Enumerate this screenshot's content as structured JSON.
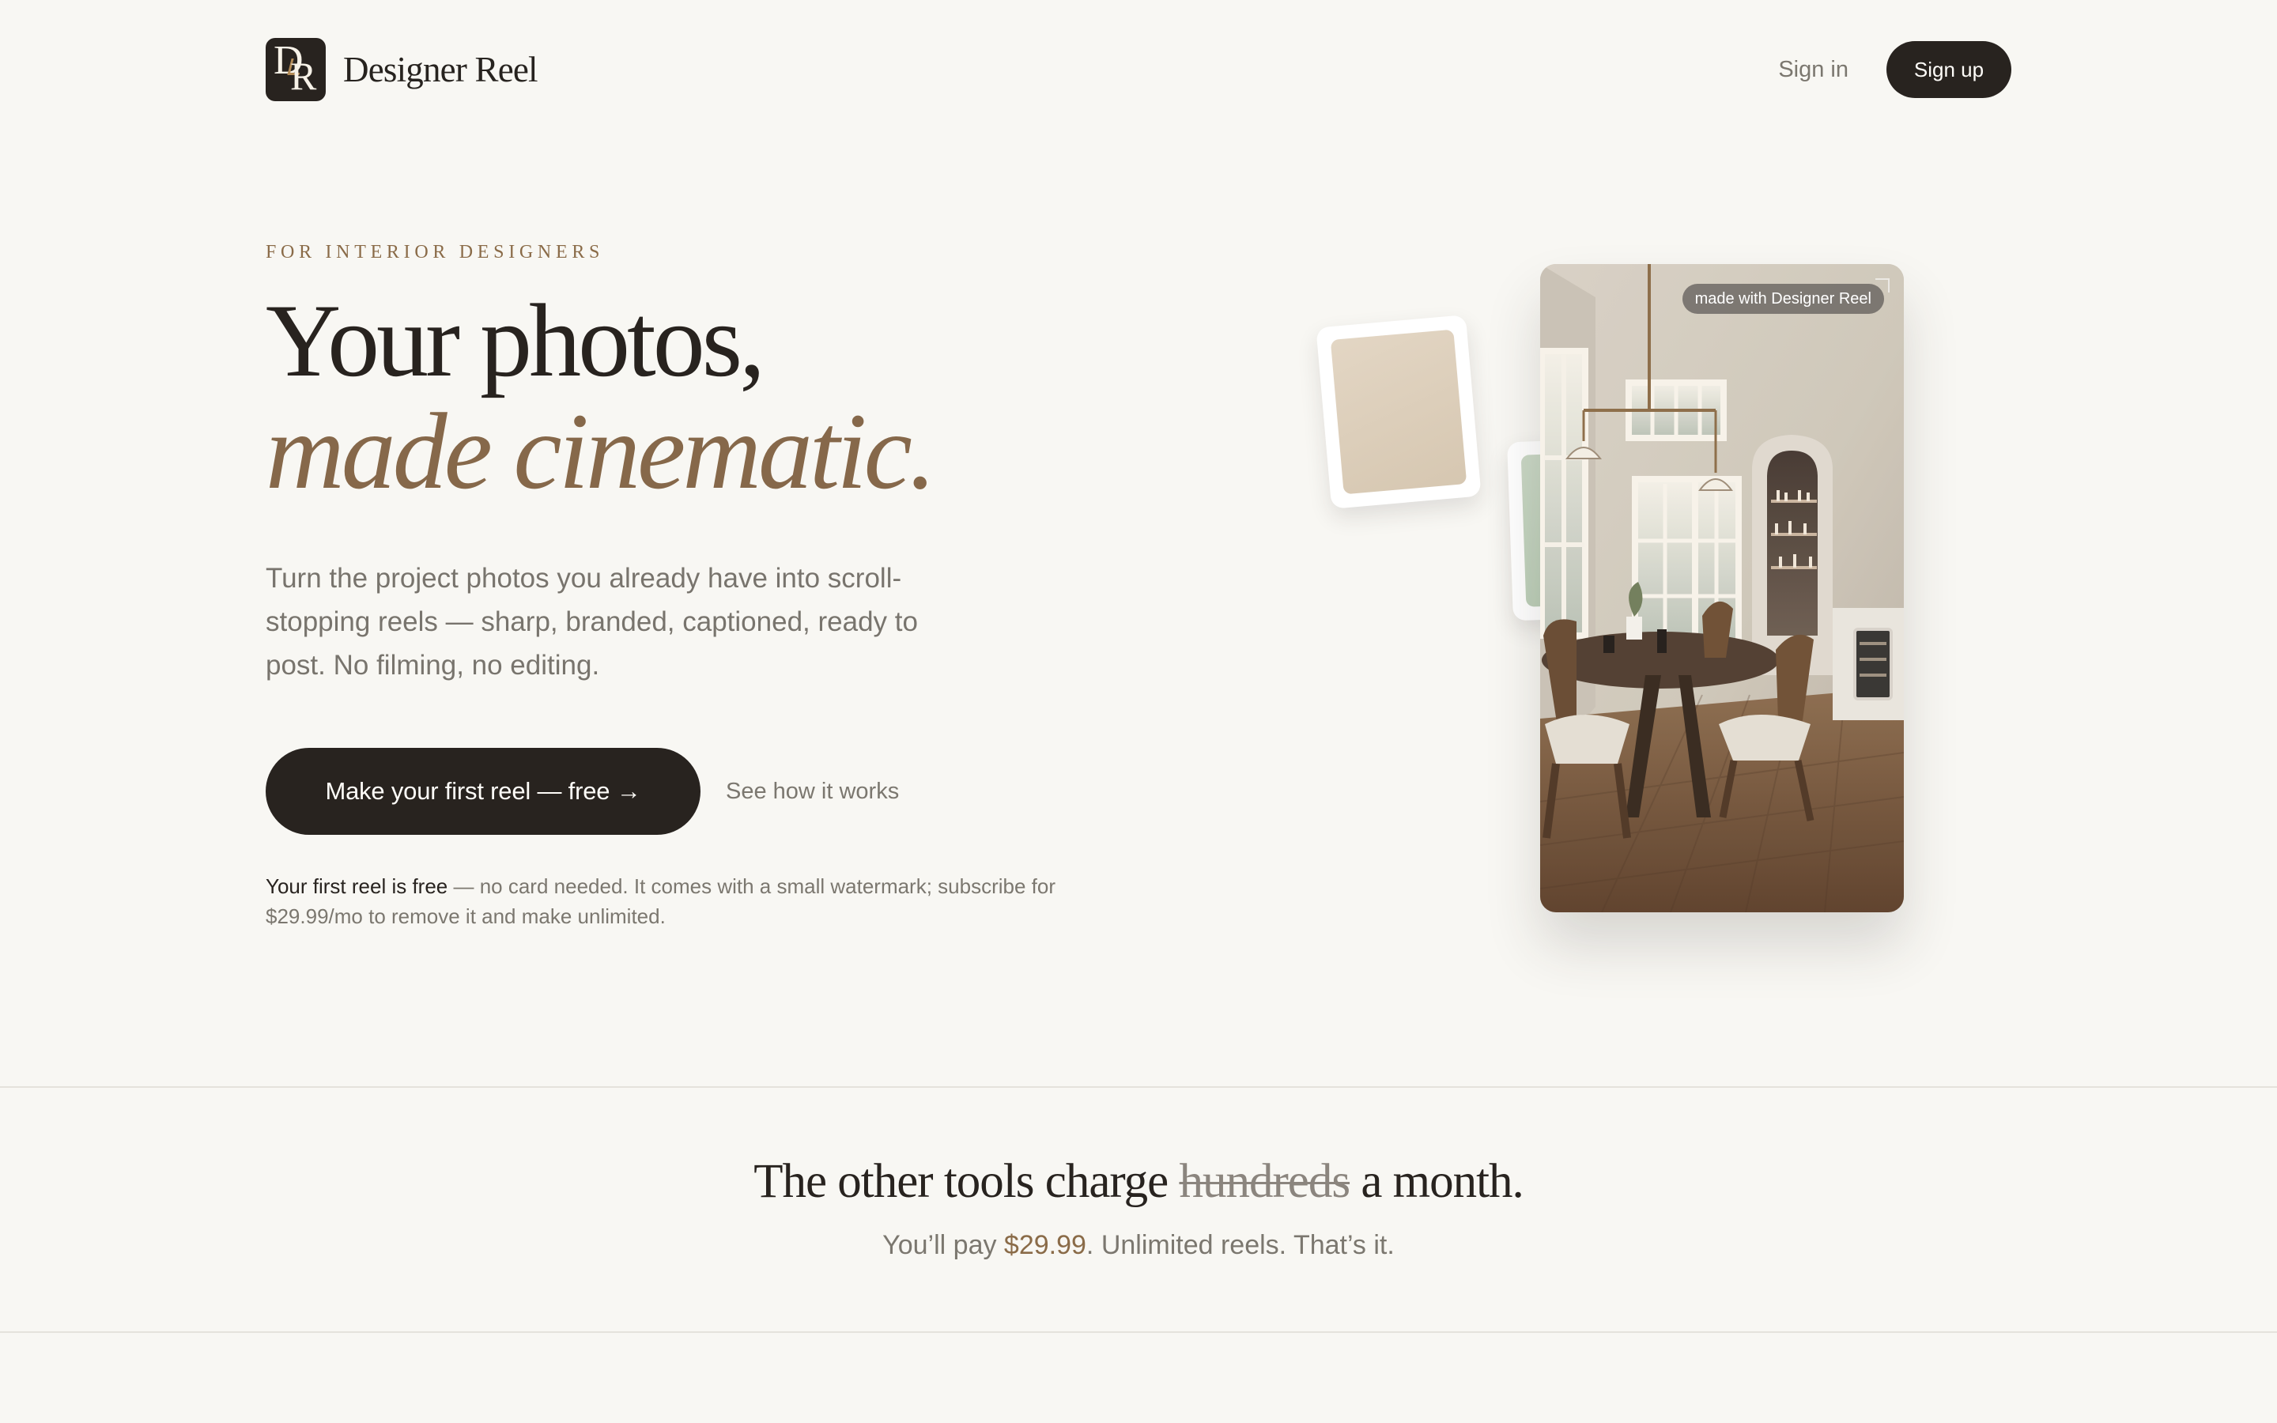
{
  "header": {
    "logo": {
      "first_letter": "D",
      "second_letter": "R"
    },
    "brand_name": "Designer Reel",
    "sign_in_label": "Sign in",
    "sign_up_label": "Sign up"
  },
  "hero": {
    "eyebrow": "FOR INTERIOR DESIGNERS",
    "headline_line_1": "Your photos,",
    "headline_line_2": "made cinematic.",
    "description": "Turn the project photos you already have into scroll-stopping reels — sharp, branded, captioned, ready to post. No filming, no editing.",
    "primary_cta_label": "Make your first reel — free →",
    "secondary_cta_label": "See how it works",
    "fine_print_emphasis": "Your first reel is free",
    "fine_print_rest": " — no card needed. It comes with a small watermark; subscribe for $29.99/mo to remove it and make unlimited."
  },
  "reel_preview": {
    "watermark": "made with Designer Reel",
    "swatch_colors": [
      "#e3d6c4",
      "#cad8c6"
    ]
  },
  "pricing": {
    "title_prefix": "The other tools charge ",
    "title_struck": "hundreds",
    "title_suffix": " a month.",
    "subtitle_prefix": "You’ll pay ",
    "price": "$29.99",
    "subtitle_suffix": ". Unlimited reels. That’s it."
  },
  "colors": {
    "background": "#f8f7f3",
    "text": "#28231f",
    "accent": "#86684a",
    "muted_text": "#7b776f"
  }
}
